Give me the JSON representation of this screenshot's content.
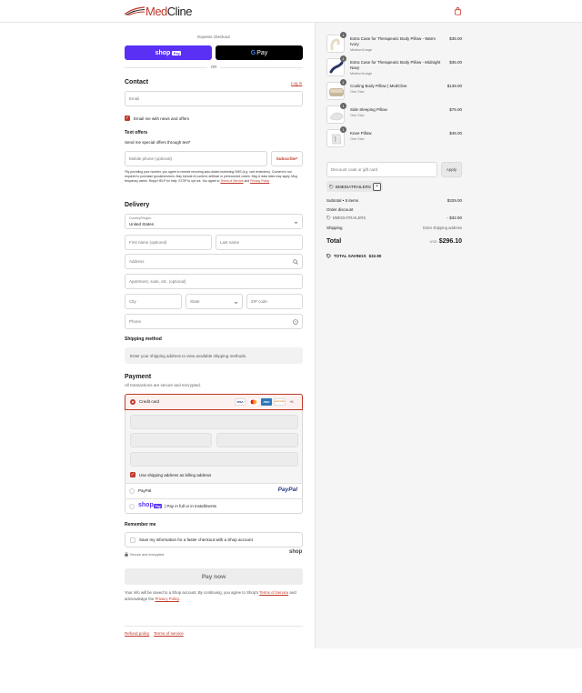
{
  "header": {
    "brand_prefix": "Med",
    "brand_suffix": "Cline",
    "cart_icon": "shopping-bag-icon"
  },
  "express": {
    "title": "Express checkout",
    "shop_pay_label": "shop",
    "shop_pay_tag": "Pay",
    "gpay_label": "Pay",
    "gpay_g": "G",
    "or_label": "OR",
    "colors": {
      "shop_pay": "#5a31f4",
      "gpay": "#000000"
    }
  },
  "contact": {
    "title": "Contact",
    "login_link": "Log in",
    "email_placeholder": "Email",
    "news_label": "Email me with news and offers",
    "text_offers_title": "Text offers",
    "text_offers_sub": "Send me special offers through text*",
    "mobile_placeholder": "Mobile phone (optional)",
    "subscribe_label": "Subscribe*",
    "disclaimer": "*By providing your number, you agree to receive recurring auto-dialed marketing SMS (e.g. cart reminders). Consent is not required to purchase goods/services. May include AI content, artificial or prerecorded voices. Msg & data rates may apply. Msg frequency varies. Reply HELP for help; STOP to opt out. You agree to",
    "disclaimer_terms": "Terms of Service",
    "disclaimer_and": "and",
    "disclaimer_privacy": "Privacy Policy"
  },
  "delivery": {
    "title": "Delivery",
    "country_label": "Country/Region",
    "country_value": "United States",
    "first_name": "First name (optional)",
    "last_name": "Last name",
    "address": "Address",
    "apartment": "Apartment, suite, etc. (optional)",
    "city": "City",
    "state": "State",
    "zip": "ZIP code",
    "phone": "Phone"
  },
  "shipping_method": {
    "title": "Shipping method",
    "message": "Enter your shipping address to view available shipping methods."
  },
  "payment": {
    "title": "Payment",
    "subtitle": "All transactions are secure and encrypted.",
    "credit_card": "Credit card",
    "card_more": "+6",
    "use_shipping": "Use shipping address as billing address",
    "paypal": "PayPal",
    "paypal_logo": "PayPal",
    "shop_logo": "shop",
    "shop_tag": "Pay",
    "shop_installments": "| Pay in full or in installments",
    "card_brands": [
      "VISA",
      "mastercard",
      "AMEX",
      "DISCOVER"
    ]
  },
  "remember": {
    "title": "Remember me",
    "save_label": "Save my information for a faster checkout with a Shop account",
    "secure": "Secure and encrypted",
    "shop_word": "shop"
  },
  "pay_now": "Pay now",
  "legal": {
    "text": "Your info will be saved to a Shop account. By continuing, you agree to Shop's",
    "terms": "Terms of Service",
    "and_ack": "and acknowledge the",
    "privacy": "Privacy Policy",
    "period": "."
  },
  "footer": {
    "refund": "Refund policy",
    "terms": "Terms of service"
  },
  "order": {
    "items": [
      {
        "qty": "1",
        "name": "Extra Case for Therapeutic Body Pillow - Warm Ivory",
        "variant": "Medium/Large",
        "price": "$35.00"
      },
      {
        "qty": "1",
        "name": "Extra Case for Therapeutic Body Pillow - Midnight Navy",
        "variant": "Medium/Large",
        "price": "$35.00"
      },
      {
        "qty": "1",
        "name": "Cooling Body Pillow | MedCline",
        "variant": "One Size",
        "price": "$139.00"
      },
      {
        "qty": "1",
        "name": "Side Sleeping Pillow",
        "variant": "One Size",
        "price": "$75.00"
      },
      {
        "qty": "1",
        "name": "Knee Pillow",
        "variant": "One Size",
        "price": "$45.00"
      }
    ],
    "discount_placeholder": "Discount code or gift card",
    "apply_label": "Apply",
    "code_tag": "BMEDIATRAILERS",
    "subtotal_label": "Subtotal • 5 items",
    "subtotal_value": "$329.00",
    "order_discount_label": "Order discount",
    "discount_code": "BMEDIATRAILERS",
    "discount_value": "- $32.90",
    "shipping_label": "Shipping",
    "shipping_value": "Enter shipping address",
    "total_label": "Total",
    "currency": "USD",
    "total_value": "$296.10",
    "savings_label": "TOTAL SAVINGS",
    "savings_value": "$32.90"
  }
}
